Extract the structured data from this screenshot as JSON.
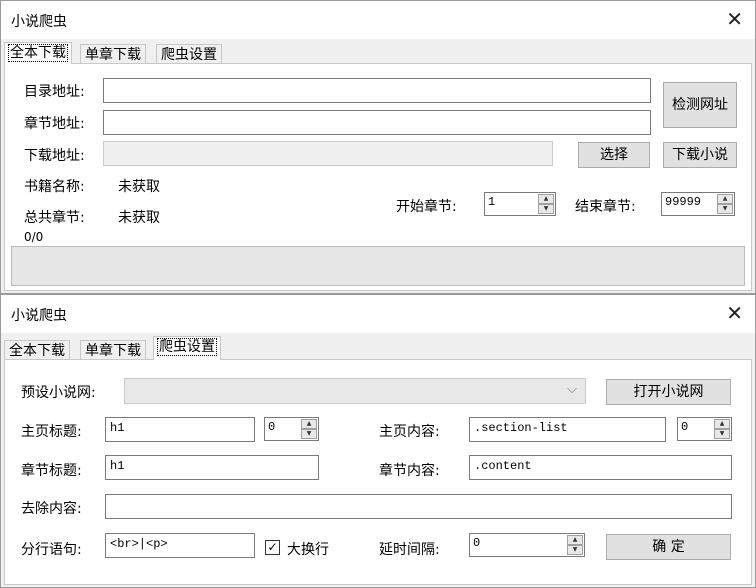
{
  "window_title": "小说爬虫",
  "close_glyph": "✕",
  "tabs": [
    "全本下载",
    "单章下载",
    "爬虫设置"
  ],
  "spin_up_glyph": "▲",
  "spin_down_glyph": "▼",
  "full_download": {
    "catalog_url_label": "目录地址:",
    "catalog_url_value": "",
    "chapter_url_label": "章节地址:",
    "chapter_url_value": "",
    "download_path_label": "下载地址:",
    "download_path_value": "",
    "detect_button": "检测网址",
    "choose_button": "选择",
    "download_button": "下载小说",
    "book_name_label": "书籍名称:",
    "book_name_value": "未获取",
    "total_chapters_label": "总共章节:",
    "total_chapters_value": "未获取",
    "start_chapter_label": "开始章节:",
    "start_chapter_value": "1",
    "end_chapter_label": "结束章节:",
    "end_chapter_value": "99999",
    "progress_text": "0/0",
    "progress_fraction": 0
  },
  "crawler_settings": {
    "preset_label": "预设小说网:",
    "preset_value": "",
    "preset_chevron": "⌵",
    "open_site_button": "打开小说网",
    "home_title_label": "主页标题:",
    "home_title_value": "h1",
    "home_title_index": "0",
    "home_content_label": "主页内容:",
    "home_content_value": ".section-list",
    "home_content_index": "0",
    "chapter_title_label": "章节标题:",
    "chapter_title_value": "h1",
    "chapter_content_label": "章节内容:",
    "chapter_content_value": ".content",
    "remove_content_label": "去除内容:",
    "remove_content_value": "",
    "line_break_label": "分行语句:",
    "line_break_value": "<br>|<p>",
    "big_break_label": "大换行",
    "big_break_checked": true,
    "check_glyph": "✓",
    "delay_label": "延时间隔:",
    "delay_value": "0",
    "confirm_button": "确 定"
  }
}
